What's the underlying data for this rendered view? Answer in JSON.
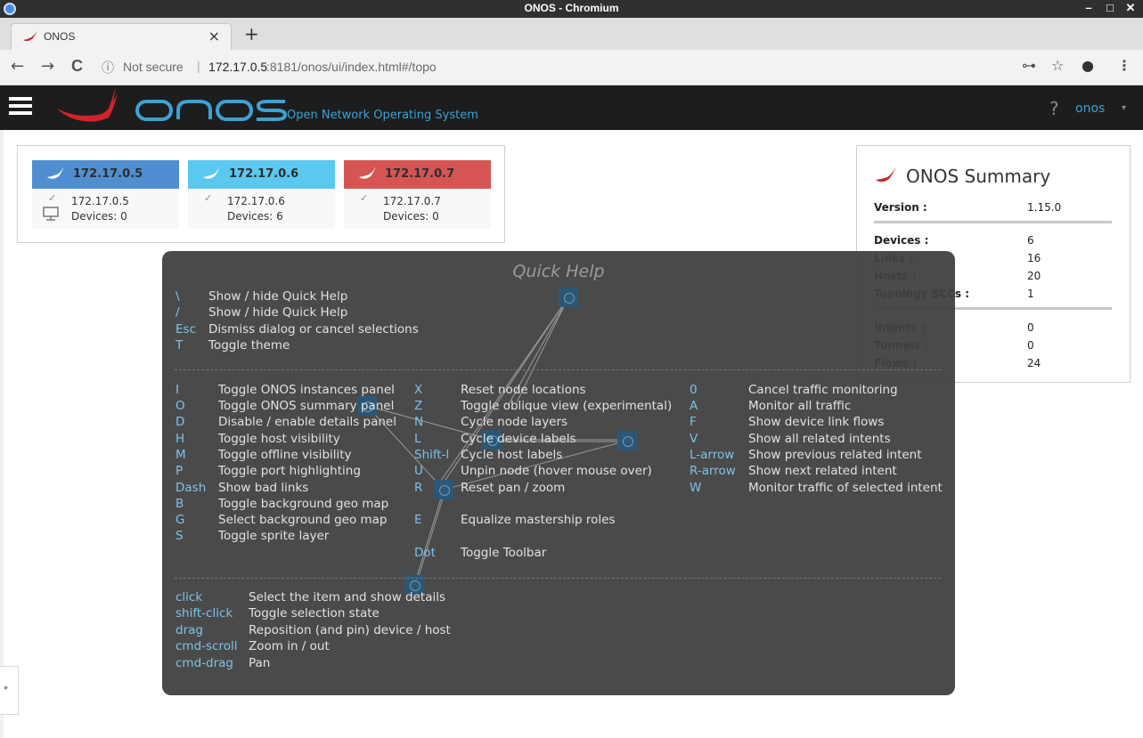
{
  "window": {
    "title": "ONOS - Chromium",
    "controls": [
      "–",
      "□",
      "✕"
    ]
  },
  "tab": {
    "label": "ONOS",
    "close": "×",
    "new_tab": "+"
  },
  "toolbar": {
    "back": "←",
    "forward": "→",
    "reload": "C",
    "info_icon": "ⓘ",
    "security": "Not secure",
    "separator": "|",
    "url_host": "172.17.0.5",
    "url_rest": ":8181/onos/ui/index.html#/topo",
    "key_icon": "⊶",
    "star_icon": "☆",
    "account_icon": "●",
    "menu_icon": "⋮"
  },
  "masthead": {
    "tagline": "Open Network Operating System",
    "help": "?",
    "user": "onos",
    "caret": "▾"
  },
  "instances": [
    {
      "header": "172.17.0.5",
      "check": "✓",
      "ip": "172.17.0.5",
      "devices": "Devices: 0",
      "color": "#4f8fd1",
      "has_monitor": true
    },
    {
      "header": "172.17.0.6",
      "check": "✓",
      "ip": "172.17.0.6",
      "devices": "Devices: 6",
      "color": "#5bc8ef",
      "has_monitor": false
    },
    {
      "header": "172.17.0.7",
      "check": "✓",
      "ip": "172.17.0.7",
      "devices": "Devices: 0",
      "color": "#d45553",
      "has_monitor": false
    }
  ],
  "summary": {
    "title": "ONOS Summary",
    "rows": [
      {
        "key": "Version :",
        "value": "1.15.0"
      },
      {
        "key": "Devices :",
        "value": "6"
      },
      {
        "key": "Links :",
        "value": "16"
      },
      {
        "key": "Hosts :",
        "value": "20"
      },
      {
        "key": "Topology SCCs :",
        "value": "1"
      },
      {
        "key": "Intents :",
        "value": "0"
      },
      {
        "key": "Tunnels :",
        "value": "0"
      },
      {
        "key": "Flows :",
        "value": "24"
      }
    ]
  },
  "quick_help": {
    "title": "Quick Help",
    "general": [
      {
        "key": "\\",
        "desc": "Show / hide Quick Help"
      },
      {
        "key": "/",
        "desc": "Show / hide Quick Help"
      },
      {
        "key": "Esc",
        "desc": "Dismiss dialog or cancel selections"
      },
      {
        "key": "T",
        "desc": "Toggle theme"
      }
    ],
    "col1": [
      {
        "key": "I",
        "desc": "Toggle ONOS instances panel"
      },
      {
        "key": "O",
        "desc": "Toggle ONOS summary panel"
      },
      {
        "key": "D",
        "desc": "Disable / enable details panel"
      },
      {
        "key": "H",
        "desc": "Toggle host visibility"
      },
      {
        "key": "M",
        "desc": "Toggle offline visibility"
      },
      {
        "key": "P",
        "desc": "Toggle port highlighting"
      },
      {
        "key": "Dash",
        "desc": "Show bad links"
      },
      {
        "key": "B",
        "desc": "Toggle background geo map"
      },
      {
        "key": "G",
        "desc": "Select background geo map"
      },
      {
        "key": "S",
        "desc": "Toggle sprite layer"
      }
    ],
    "col2": [
      {
        "key": "X",
        "desc": "Reset node locations"
      },
      {
        "key": "Z",
        "desc": "Toggle oblique view (experimental)"
      },
      {
        "key": "N",
        "desc": "Cycle node layers"
      },
      {
        "key": "L",
        "desc": "Cycle device labels"
      },
      {
        "key": "Shift-l",
        "desc": "Cycle host labels"
      },
      {
        "key": "U",
        "desc": "Unpin node (hover mouse over)"
      },
      {
        "key": "R",
        "desc": "Reset pan / zoom"
      },
      {
        "key": "E",
        "desc": "Equalize mastership roles"
      },
      {
        "key": "Dot",
        "desc": "Toggle Toolbar"
      }
    ],
    "col3": [
      {
        "key": "0",
        "desc": "Cancel traffic monitoring"
      },
      {
        "key": "A",
        "desc": "Monitor all traffic"
      },
      {
        "key": "F",
        "desc": "Show device link flows"
      },
      {
        "key": "V",
        "desc": "Show all related intents"
      },
      {
        "key": "L-arrow",
        "desc": "Show previous related intent"
      },
      {
        "key": "R-arrow",
        "desc": "Show next related intent"
      },
      {
        "key": "W",
        "desc": "Monitor traffic of selected intent"
      }
    ],
    "mouse": [
      {
        "key": "click",
        "desc": "Select the item and show details"
      },
      {
        "key": "shift-click",
        "desc": "Toggle selection state"
      },
      {
        "key": "drag",
        "desc": "Reposition (and pin) device / host"
      },
      {
        "key": "cmd-scroll",
        "desc": "Zoom in / out"
      },
      {
        "key": "cmd-drag",
        "desc": "Pan"
      }
    ]
  },
  "side_toggle": {
    "arrow": "▸"
  }
}
